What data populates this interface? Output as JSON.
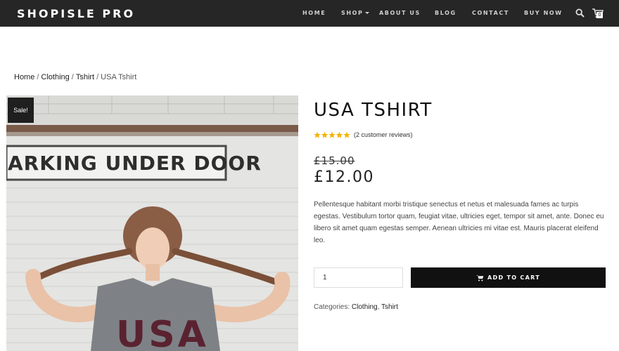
{
  "brand": "SHOPISLE PRO",
  "nav": {
    "items": [
      {
        "label": "HOME"
      },
      {
        "label": "SHOP"
      },
      {
        "label": "ABOUT US"
      },
      {
        "label": "BLOG"
      },
      {
        "label": "CONTACT"
      },
      {
        "label": "BUY NOW"
      }
    ],
    "cart_count": "0"
  },
  "breadcrumb": {
    "items": [
      "Home",
      "Clothing",
      "Tshirt"
    ],
    "current": "USA Tshirt",
    "separator": "/"
  },
  "image": {
    "sign_text": "ARKING UNDER DOOR",
    "shirt_text": "USA"
  },
  "sale_badge": "Sale!",
  "product": {
    "title": "USA TSHIRT",
    "rating": 5,
    "reviews": "(2 customer reviews)",
    "old_price": "£15.00",
    "price": "£12.00",
    "description": "Pellentesque habitant morbi tristique senectus et netus et malesuada fames ac turpis egestas. Vestibulum tortor quam, feugiat vitae, ultricies eget, tempor sit amet, ante. Donec eu libero sit amet quam egestas semper. Aenean ultricies mi vitae est. Mauris placerat eleifend leo.",
    "quantity": "1",
    "add_to_cart": "ADD TO CART",
    "categories_label": "Categories:",
    "categories": [
      "Clothing",
      "Tshirt"
    ]
  },
  "colors": {
    "navbar": "#262626",
    "button": "#111111",
    "star": "#f5b301"
  },
  "icons": {
    "search": "search-icon",
    "cart": "cart-icon",
    "star": "star-icon"
  }
}
